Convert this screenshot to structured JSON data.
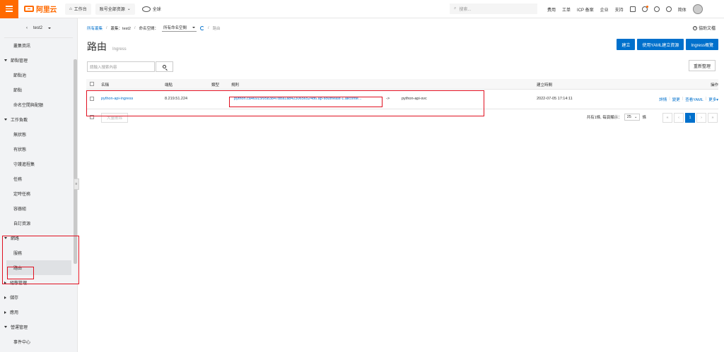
{
  "topbar": {
    "logo": "阿里云",
    "workbench": "工作台",
    "resources": "账号全部资源",
    "region": "全球",
    "search_placeholder": "搜索...",
    "links": [
      "费用",
      "工单",
      "ICP 备案",
      "企业",
      "支持"
    ],
    "lang": "简体"
  },
  "sidebar": {
    "cluster": "test2",
    "items": [
      {
        "type": "item",
        "label": "叢集資訊"
      },
      {
        "type": "group",
        "label": "節點管理",
        "open": true
      },
      {
        "type": "item",
        "label": "節點池"
      },
      {
        "type": "item",
        "label": "節點"
      },
      {
        "type": "item",
        "label": "命名空間與配額"
      },
      {
        "type": "group",
        "label": "工作負載",
        "open": true
      },
      {
        "type": "item",
        "label": "無狀態"
      },
      {
        "type": "item",
        "label": "有狀態"
      },
      {
        "type": "item",
        "label": "守護進程集"
      },
      {
        "type": "item",
        "label": "任務"
      },
      {
        "type": "item",
        "label": "定時任務"
      },
      {
        "type": "item",
        "label": "容器組"
      },
      {
        "type": "item",
        "label": "自訂資源"
      },
      {
        "type": "group",
        "label": "網路",
        "open": true
      },
      {
        "type": "item",
        "label": "服務"
      },
      {
        "type": "item",
        "label": "路由",
        "active": true
      },
      {
        "type": "group",
        "label": "組態管理",
        "open": false
      },
      {
        "type": "group",
        "label": "儲存",
        "open": false
      },
      {
        "type": "group",
        "label": "應用",
        "open": false
      },
      {
        "type": "group",
        "label": "營運管理",
        "open": true
      },
      {
        "type": "item",
        "label": "事件中心"
      }
    ]
  },
  "breadcrumb": {
    "root": "所有叢集",
    "sep": "/",
    "cluster_label": "叢集：test2",
    "namespace_label": "命名空間：",
    "namespace_value": "所有命名空間",
    "current": "路由"
  },
  "help": "協助文檔",
  "page": {
    "title": "路由",
    "subtitle": "Ingress"
  },
  "buttons": {
    "create": "建立",
    "yaml_create": "使用YAML建立資源",
    "overview": "Ingress概覽",
    "refresh": "重新整理",
    "bulk_delete": "大量刪除"
  },
  "search": {
    "placeholder": "請輸入搜索內容"
  },
  "table": {
    "columns": [
      "名稱",
      "端點",
      "類型",
      "規則",
      "建立時間",
      "操作"
    ],
    "rows": [
      {
        "name": "python-api-ingress",
        "endpoint": "8.219.51.224",
        "type": "",
        "rule_host": "python.ca46915f9583847bba1ad4230656524d6.ap-southeast-1.alicontainer.com",
        "rule_host_display": "python.ca46915f9583847bba1ad4230656524d6.ap-southeast-1.aliconte...",
        "rule_arrow": "->",
        "rule_service": "python-api-svc",
        "created": "2022-07-05 17:14:11",
        "actions": [
          "詳情",
          "變更",
          "查看YAML",
          "更多"
        ]
      }
    ]
  },
  "pagination": {
    "summary": "共有1條, 每頁顯示：",
    "page_size": "25",
    "unit": "條",
    "pages": [
      "«",
      "‹",
      "1",
      "›",
      "»"
    ],
    "current": "1"
  },
  "colors": {
    "brand": "#ff6a00",
    "primary": "#0070cc",
    "highlight_border": "#e01020"
  }
}
